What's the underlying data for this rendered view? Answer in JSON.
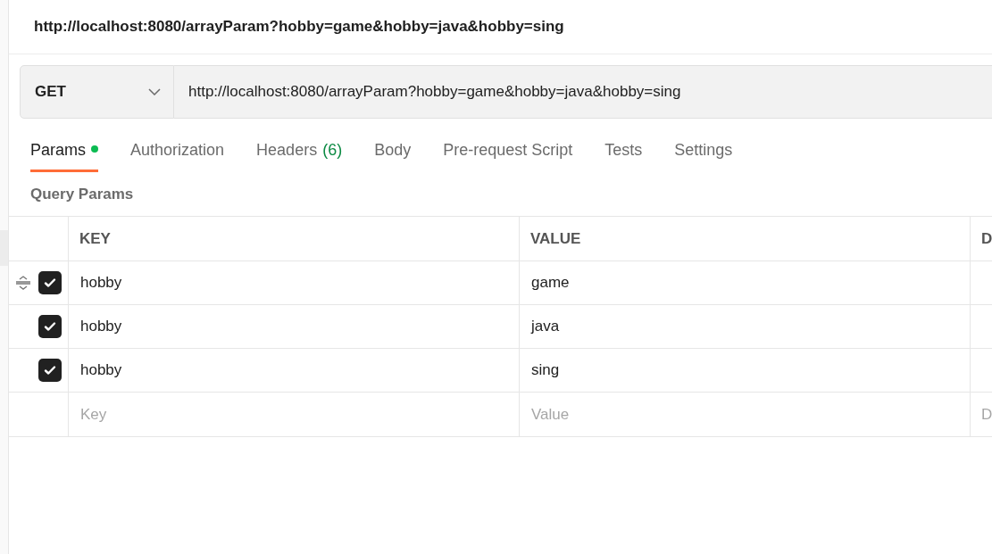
{
  "title": "http://localhost:8080/arrayParam?hobby=game&hobby=java&hobby=sing",
  "request": {
    "method": "GET",
    "url": "http://localhost:8080/arrayParam?hobby=game&hobby=java&hobby=sing"
  },
  "tabs": [
    {
      "label": "Params",
      "selected": true,
      "color": "#0cbb52"
    },
    {
      "label": "Authorization",
      "selected": false
    },
    {
      "label": "Headers",
      "count": "(6)",
      "selected": false
    },
    {
      "label": "Body",
      "selected": false
    },
    {
      "label": "Pre-request Script",
      "selected": false
    },
    {
      "label": "Tests",
      "selected": false
    },
    {
      "label": "Settings",
      "selected": false
    }
  ],
  "section_title": "Query Params",
  "table": {
    "columns": [
      "KEY",
      "VALUE",
      "D"
    ],
    "rows": [
      {
        "checked": true,
        "key": "hobby",
        "value": "game"
      },
      {
        "checked": true,
        "key": "hobby",
        "value": "java"
      },
      {
        "checked": true,
        "key": "hobby",
        "value": "sing"
      }
    ],
    "new_row": {
      "key_placeholder": "Key",
      "value_placeholder": "Value",
      "column_3_placeholder": "D"
    }
  }
}
